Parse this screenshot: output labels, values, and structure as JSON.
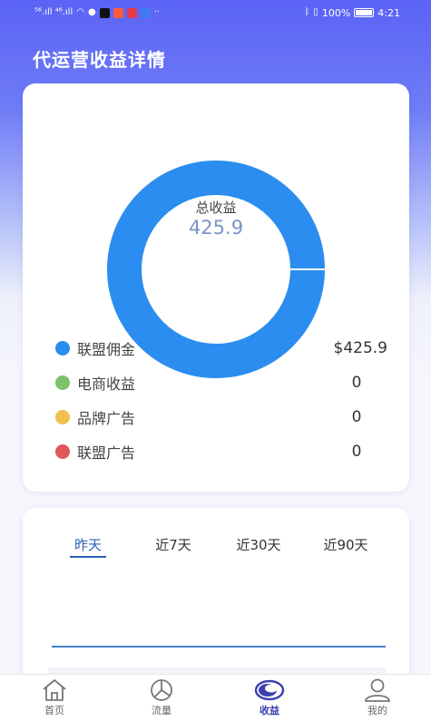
{
  "status_bar": {
    "signal": "⁵⁶.ıll ⁴⁶.ıll",
    "battery_pct": "100%",
    "time": "4:21"
  },
  "header": {
    "title": "代运营收益详情"
  },
  "summary": {
    "donut_label": "总收益",
    "donut_value": "425.9",
    "items": [
      {
        "name": "联盟佣金",
        "value": "$425.9",
        "color": "#2b8def",
        "share": 1.0
      },
      {
        "name": "电商收益",
        "value": "0",
        "color": "#7cc26a",
        "share": 0
      },
      {
        "name": "品牌广告",
        "value": "0",
        "color": "#f1c04f",
        "share": 0
      },
      {
        "name": "联盟广告",
        "value": "0",
        "color": "#e0585a",
        "share": 0
      }
    ]
  },
  "trend": {
    "tabs": [
      "昨天",
      "近7天",
      "近30天",
      "近90天"
    ],
    "active_tab": 0
  },
  "tab_bar": {
    "items": [
      {
        "label": "首页",
        "icon": "home-icon"
      },
      {
        "label": "流量",
        "icon": "pie-chart-icon"
      },
      {
        "label": "收益",
        "icon": "earnings-icon"
      },
      {
        "label": "我的",
        "icon": "profile-icon"
      }
    ],
    "active": 2
  },
  "colors": {
    "primary": "#5a63f5",
    "accent": "#2a63b8",
    "donut": "#2b8def"
  }
}
